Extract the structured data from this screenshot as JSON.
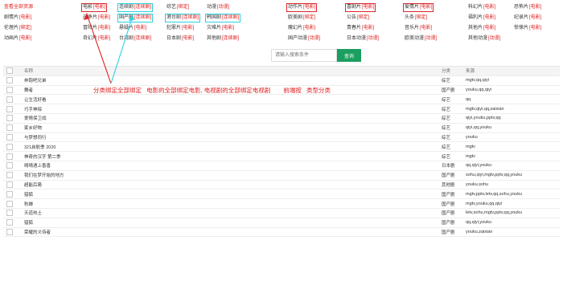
{
  "categories": [
    {
      "name": "查看全部资源",
      "bind": ""
    },
    {
      "name": "电影",
      "bind": "[电影]"
    },
    {
      "name": "连续剧",
      "bind": "[连续剧]"
    },
    {
      "name": "综艺",
      "bind": "[绑定]"
    },
    {
      "name": "动漫",
      "bind": "[动漫]"
    },
    {
      "name": "动作片",
      "bind": "[电影]"
    },
    {
      "name": "喜剧片",
      "bind": "[电影]"
    },
    {
      "name": "爱情片",
      "bind": "[电影]"
    },
    {
      "name": "科幻片",
      "bind": "[电影]"
    },
    {
      "name": "恐怖片",
      "bind": "[电影]"
    },
    {
      "name": "剧情片",
      "bind": "[电影]"
    },
    {
      "name": "战争片",
      "bind": "[电影]"
    },
    {
      "name": "国产剧",
      "bind": "[连续剧]"
    },
    {
      "name": "港台剧",
      "bind": "[连续剧]"
    },
    {
      "name": "韩国剧",
      "bind": "[连续剧]"
    },
    {
      "name": "欧美剧",
      "bind": "[绑定]"
    },
    {
      "name": "公告",
      "bind": "[绑定]"
    },
    {
      "name": "头条",
      "bind": "[绑定]"
    },
    {
      "name": "福利片",
      "bind": "[电影]"
    },
    {
      "name": "纪录片",
      "bind": "[电影]"
    },
    {
      "name": "伦理片",
      "bind": "[绑定]"
    },
    {
      "name": "冒险片",
      "bind": "[电影]"
    },
    {
      "name": "悬疑片",
      "bind": "[电影]"
    },
    {
      "name": "犯罪片",
      "bind": "[电影]"
    },
    {
      "name": "灾难片",
      "bind": "[电影]"
    },
    {
      "name": "魔幻片",
      "bind": "[电影]"
    },
    {
      "name": "青春片",
      "bind": "[电影]"
    },
    {
      "name": "音乐片",
      "bind": "[电影]"
    },
    {
      "name": "其他片",
      "bind": "[电影]"
    },
    {
      "name": "惊悚片",
      "bind": "[电影]"
    },
    {
      "name": "动画片",
      "bind": "[电影]"
    },
    {
      "name": "奇幻片",
      "bind": "[电影]"
    },
    {
      "name": "台湾剧",
      "bind": "[连续剧]"
    },
    {
      "name": "日本剧",
      "bind": "[电影]"
    },
    {
      "name": "其他剧",
      "bind": "[连续剧]"
    },
    {
      "name": "国产动漫",
      "bind": "[动漫]"
    },
    {
      "name": "日本动漫",
      "bind": "[动漫]"
    },
    {
      "name": "欧美动漫",
      "bind": "[动漫]"
    },
    {
      "name": "其他动漫",
      "bind": "[动漫]"
    }
  ],
  "search": {
    "placeholder": "请输入搜索条件",
    "button": "查询"
  },
  "table": {
    "headers": [
      "名称",
      "分类",
      "来源"
    ],
    "rows": [
      [
        "奔跑吧兄弟",
        "综艺",
        "mgtv,qq,qiyi"
      ],
      [
        "舞者",
        "国产剧",
        "youku,qq,qiyi"
      ],
      [
        "让生活好看",
        "综艺",
        "qq"
      ],
      [
        "巧手神探",
        "综艺",
        "mgtv,qiyi,qq,zaixian"
      ],
      [
        "爱情保卫战",
        "综艺",
        "qiyi,youku,pptv,qq"
      ],
      [
        "家乡好物",
        "综艺",
        "qiyi,qq,youku"
      ],
      [
        "与梦想同行",
        "综艺",
        "youku"
      ],
      [
        "321启航季 2020",
        "综艺",
        "mgtv"
      ],
      [
        "神奇的汉字 第二季",
        "综艺",
        "mgtv"
      ],
      [
        "晴晴遇上香香",
        "日本剧",
        "qq,qiyi,youku"
      ],
      [
        "我们在梦开始的地方",
        "国产剧",
        "sohu,qiyi,mgtv,pptv,qq,youku"
      ],
      [
        "超能后裔",
        "其他剧",
        "youku,sohu"
      ],
      [
        "猎狐",
        "国产剧",
        "mgtv,pptv,letv,qq,sohu,youku"
      ],
      [
        "秋蝉",
        "国产剧",
        "mgtv,youku,qq,qiyi"
      ],
      [
        "天道热土",
        "国产剧",
        "letv,sohu,mgtv,pptv,qq,youku"
      ],
      [
        "猎狐",
        "国产剧",
        "qq,qiyi,youku"
      ],
      [
        "荣耀的义侍者",
        "国产剧",
        "youku,zaixian"
      ]
    ]
  },
  "annotation": {
    "parts": [
      "分类绑定全部绑定",
      "电影的全部绑定电影, 电视剧的全部绑定电视剧",
      "前端按",
      "类型分类"
    ]
  },
  "colors": {
    "accent": "#1b9e5f",
    "red": "#e02020",
    "cyan": "#2ad0e0"
  }
}
